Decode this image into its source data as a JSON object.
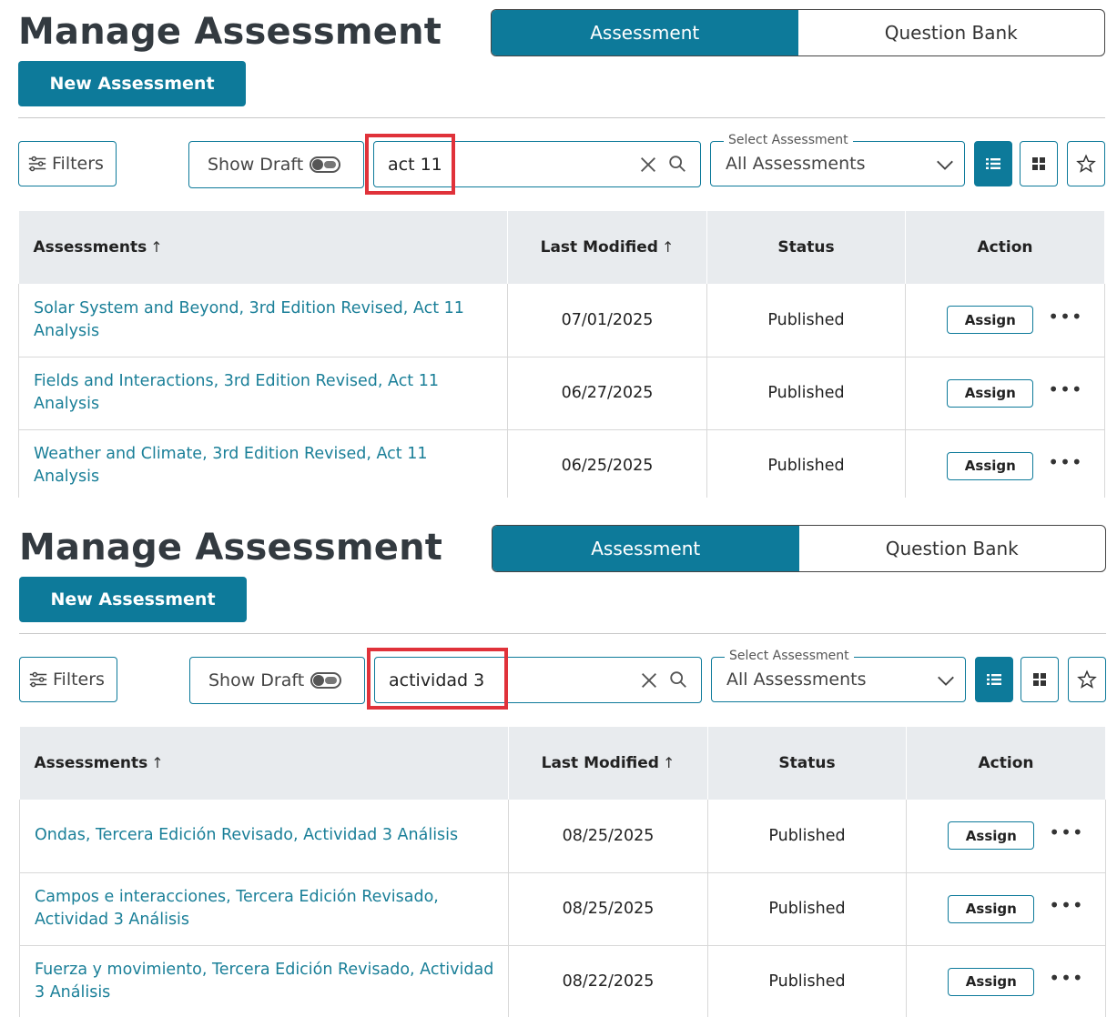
{
  "colors": {
    "accent": "#0d7a9a",
    "highlight": "#e0323a",
    "link": "#1a7f98"
  },
  "panels": [
    {
      "title": "Manage Assessment",
      "tabs": [
        {
          "label": "Assessment",
          "active": true
        },
        {
          "label": "Question Bank",
          "active": false
        }
      ],
      "new_button": "New Assessment",
      "filters_label": "Filters",
      "show_draft_label": "Show Draft",
      "search_value": "act 11",
      "select_label": "Select Assessment",
      "select_value": "All Assessments",
      "columns": {
        "name": "Assessments",
        "modified": "Last Modified",
        "status": "Status",
        "action": "Action"
      },
      "rows": [
        {
          "name": "Solar System and Beyond, 3rd Edition Revised, Act 11 Analysis",
          "modified": "07/01/2025",
          "status": "Published",
          "assign": "Assign"
        },
        {
          "name": "Fields and Interactions, 3rd Edition Revised, Act 11 Analysis",
          "modified": "06/27/2025",
          "status": "Published",
          "assign": "Assign"
        },
        {
          "name": "Weather and Climate, 3rd Edition Revised, Act 11 Analysis",
          "modified": "06/25/2025",
          "status": "Published",
          "assign": "Assign"
        }
      ]
    },
    {
      "title": "Manage Assessment",
      "tabs": [
        {
          "label": "Assessment",
          "active": true
        },
        {
          "label": "Question Bank",
          "active": false
        }
      ],
      "new_button": "New Assessment",
      "filters_label": "Filters",
      "show_draft_label": "Show Draft",
      "search_value": "actividad 3",
      "select_label": "Select Assessment",
      "select_value": "All Assessments",
      "columns": {
        "name": "Assessments",
        "modified": "Last Modified",
        "status": "Status",
        "action": "Action"
      },
      "rows": [
        {
          "name": "Ondas, Tercera Edición Revisado, Actividad 3 Análisis",
          "modified": "08/25/2025",
          "status": "Published",
          "assign": "Assign"
        },
        {
          "name": "Campos e interacciones, Tercera Edición Revisado, Actividad 3 Análisis",
          "modified": "08/25/2025",
          "status": "Published",
          "assign": "Assign"
        },
        {
          "name": "Fuerza y movimiento, Tercera Edición Revisado, Actividad 3 Análisis",
          "modified": "08/22/2025",
          "status": "Published",
          "assign": "Assign"
        }
      ]
    }
  ]
}
